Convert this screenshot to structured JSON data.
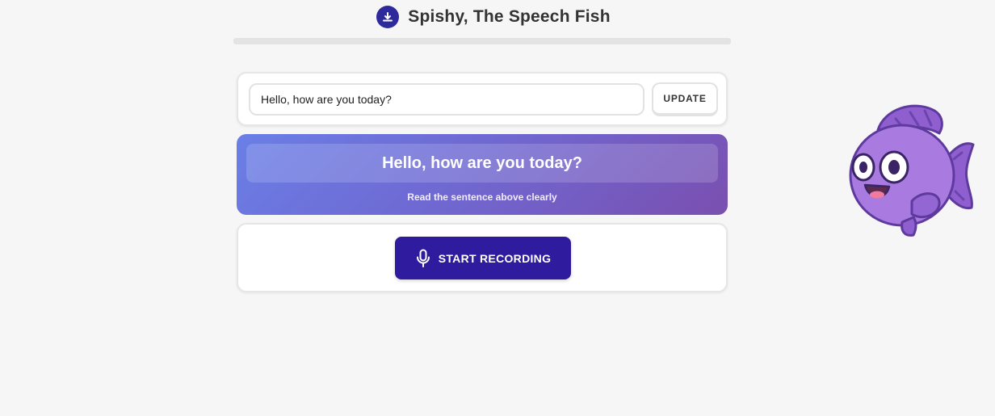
{
  "header": {
    "title": "Spishy, The Speech Fish",
    "logo_icon": "download-circle-icon"
  },
  "progress": {
    "value": 0
  },
  "input": {
    "value": "Hello, how are you today?",
    "update_label": "UPDATE"
  },
  "prompt": {
    "sentence": "Hello, how are you today?",
    "hint": "Read the sentence above clearly"
  },
  "record": {
    "label": "START RECORDING",
    "icon": "microphone-icon"
  },
  "mascot": {
    "icon": "fish-mascot"
  },
  "colors": {
    "background": "#f6f6f6",
    "brand": "#2e2a9b",
    "record_button": "#2f1b9d",
    "gradient_start": "#6a7fe6",
    "gradient_end": "#7a4fb0",
    "fish_body": "#a97be0"
  }
}
